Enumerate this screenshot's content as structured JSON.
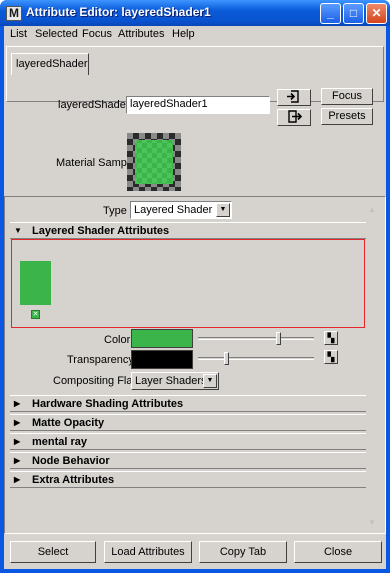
{
  "window": {
    "title": "Attribute Editor: layeredShader1"
  },
  "titlebar": {
    "minimize": "_",
    "maximize": "□",
    "close": "✕"
  },
  "menu": [
    "List",
    "Selected",
    "Focus",
    "Attributes",
    "Help"
  ],
  "tabs": [
    "layeredShader"
  ],
  "node": {
    "label": "layeredShader:",
    "value": "layeredShader1"
  },
  "buttons": {
    "focus": "Focus",
    "presets": "Presets"
  },
  "material_sample": {
    "label": "Material Sample"
  },
  "type": {
    "label": "Type",
    "value": "Layered Shader"
  },
  "sections": {
    "layered": "Layered Shader Attributes",
    "hardware": "Hardware Shading Attributes",
    "matte": "Matte Opacity",
    "mental_ray": "mental ray",
    "node_behavior": "Node Behavior",
    "extra": "Extra Attributes"
  },
  "attributes": {
    "color": {
      "label": "Color",
      "swatch": "#3bb54a",
      "slider": 0.7
    },
    "transparency": {
      "label": "Transparency",
      "swatch": "#000000",
      "slider": 0.23
    },
    "compositing": {
      "label": "Compositing Flag",
      "value": "Layer Shaders"
    }
  },
  "bottom_buttons": [
    "Select",
    "Load Attributes",
    "Copy Tab",
    "Close"
  ]
}
